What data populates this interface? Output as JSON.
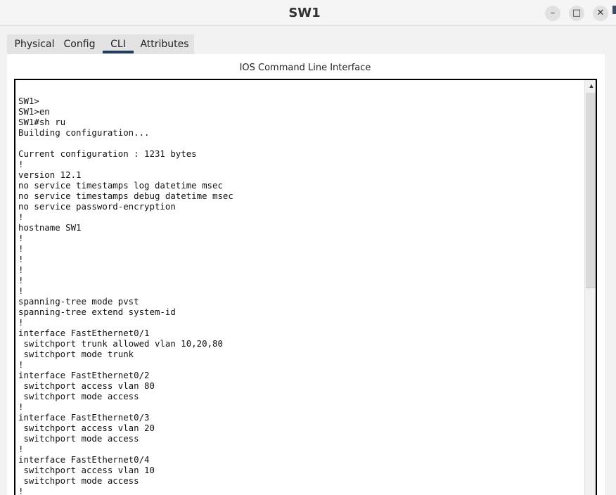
{
  "window": {
    "title": "SW1",
    "controls": {
      "minimize": "–",
      "maximize": "□",
      "close": "✕"
    }
  },
  "tabs": [
    {
      "label": "Physical",
      "active": false
    },
    {
      "label": "Config",
      "active": false
    },
    {
      "label": "CLI",
      "active": true
    },
    {
      "label": "Attributes",
      "active": false
    }
  ],
  "panel": {
    "title": "IOS Command Line Interface"
  },
  "terminal": {
    "lines": [
      "SW1>",
      "SW1>en",
      "SW1#sh ru",
      "Building configuration...",
      "",
      "Current configuration : 1231 bytes",
      "!",
      "version 12.1",
      "no service timestamps log datetime msec",
      "no service timestamps debug datetime msec",
      "no service password-encryption",
      "!",
      "hostname SW1",
      "!",
      "!",
      "!",
      "!",
      "!",
      "!",
      "spanning-tree mode pvst",
      "spanning-tree extend system-id",
      "!",
      "interface FastEthernet0/1",
      " switchport trunk allowed vlan 10,20,80",
      " switchport mode trunk",
      "!",
      "interface FastEthernet0/2",
      " switchport access vlan 80",
      " switchport mode access",
      "!",
      "interface FastEthernet0/3",
      " switchport access vlan 20",
      " switchport mode access",
      "!",
      "interface FastEthernet0/4",
      " switchport access vlan 10",
      " switchport mode access",
      "!"
    ]
  },
  "scrollbar": {
    "up_arrow": "▲"
  },
  "colors": {
    "active_tab_underline": "#1f3c5a",
    "terminal_border": "#000000",
    "terminal_background": "#ffffff"
  }
}
